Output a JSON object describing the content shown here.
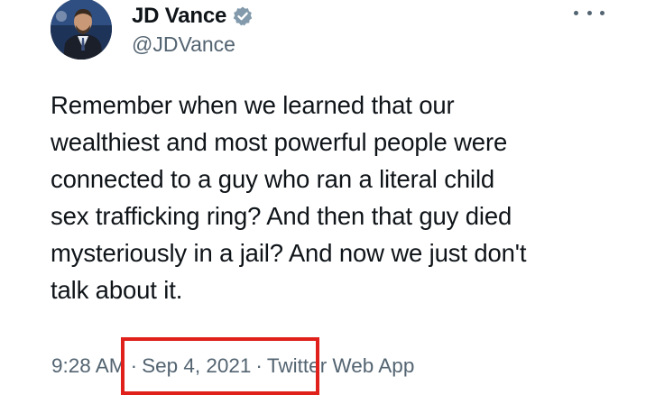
{
  "author": {
    "display_name": "JD Vance",
    "handle": "@JDVance",
    "verified": true,
    "avatar_icon": "profile-photo"
  },
  "menu": {
    "icon": "more-horizontal-icon"
  },
  "tweet": {
    "text_lines": [
      "Remember when we learned that our",
      "wealthiest and most powerful people were",
      "connected to a guy who ran a literal child",
      "sex trafficking ring? And then that guy died",
      "mysteriously in a jail? And now we just don't",
      "talk about it."
    ]
  },
  "meta": {
    "time": "9:28 AM",
    "separator": "·",
    "date": "Sep 4, 2021",
    "source": "Twitter Web App"
  },
  "annotation": {
    "color": "#e0201b"
  },
  "colors": {
    "text": "#0f1419",
    "secondary": "#536471",
    "verified": "#829aab"
  }
}
